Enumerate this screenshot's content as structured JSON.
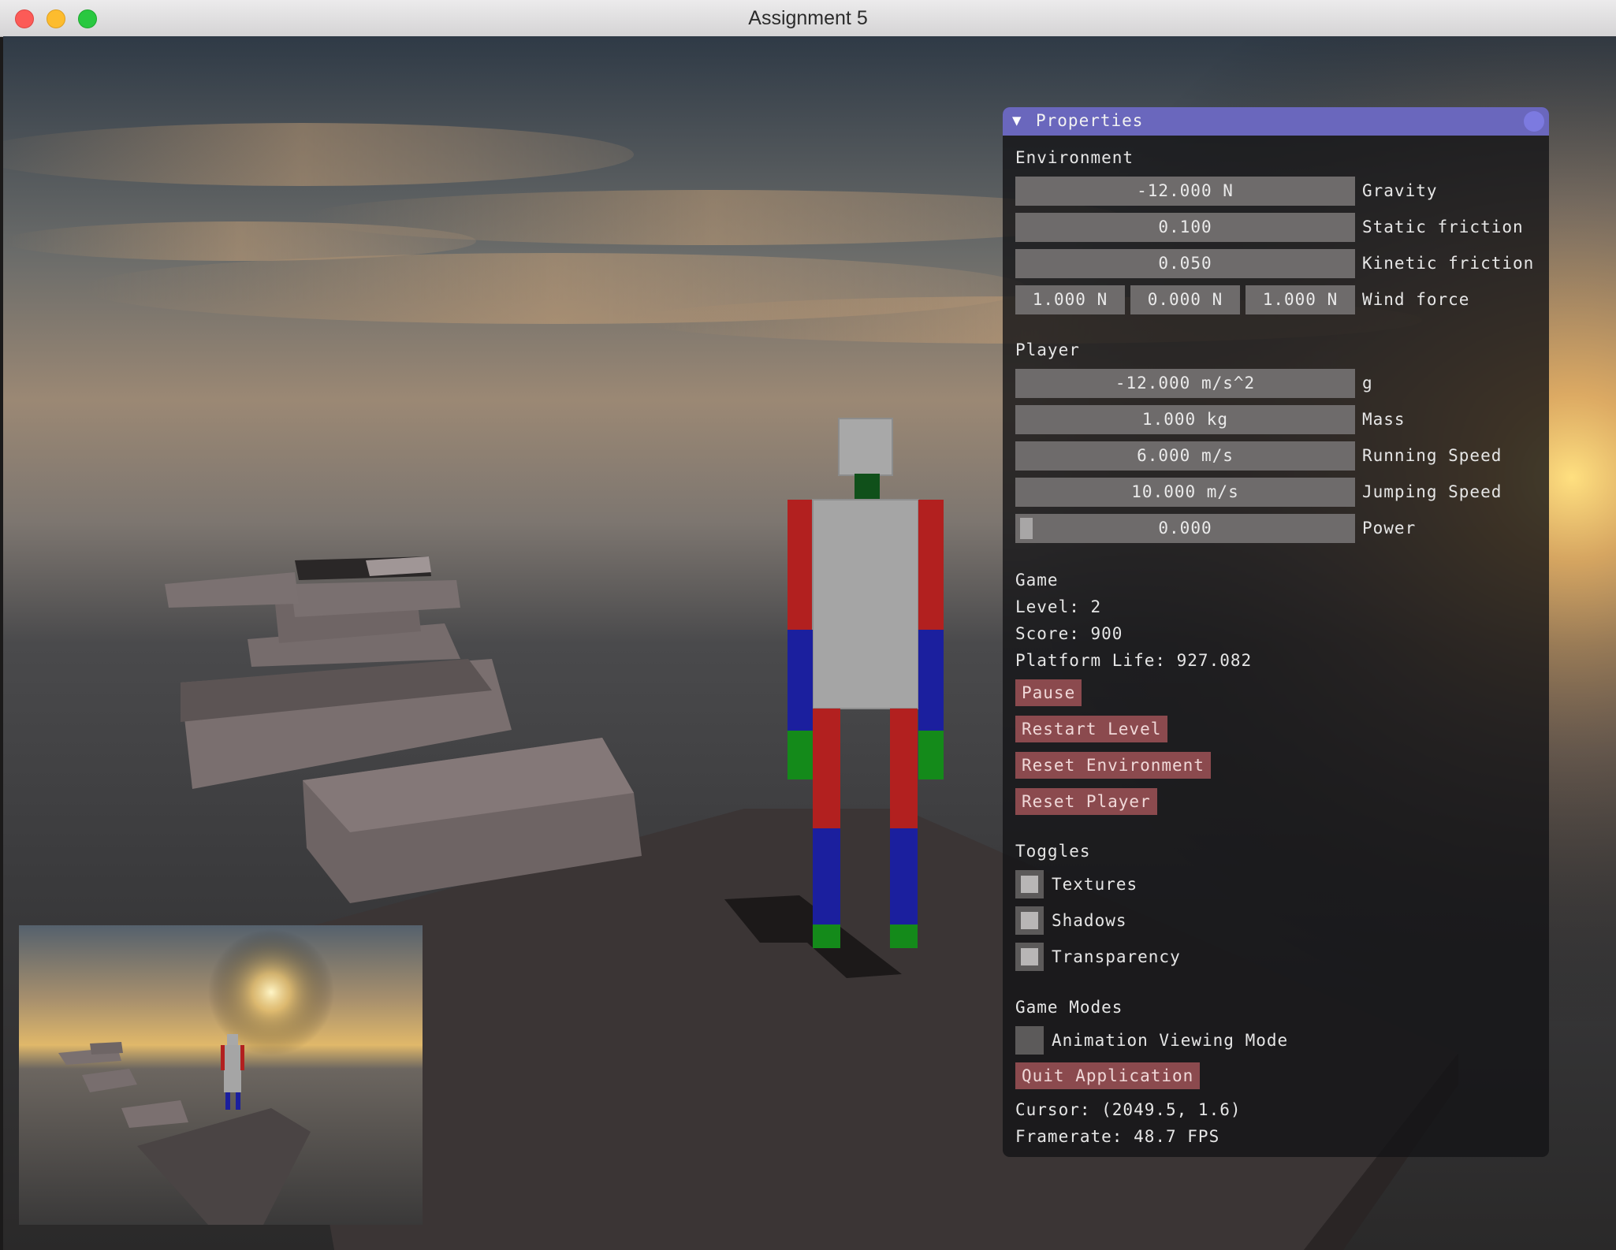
{
  "window": {
    "title": "Assignment 5"
  },
  "properties": {
    "title": "Properties",
    "environment": {
      "heading": "Environment",
      "gravity": {
        "value": "-12.000 N",
        "label": "Gravity"
      },
      "static_friction": {
        "value": "0.100",
        "label": "Static friction"
      },
      "kinetic_friction": {
        "value": "0.050",
        "label": "Kinetic friction"
      },
      "wind_force": {
        "x": "1.000 N",
        "y": "0.000 N",
        "z": "1.000 N",
        "label": "Wind force"
      }
    },
    "player": {
      "heading": "Player",
      "g": {
        "value": "-12.000 m/s^2",
        "label": "g"
      },
      "mass": {
        "value": "1.000 kg",
        "label": "Mass"
      },
      "running_speed": {
        "value": "6.000 m/s",
        "label": "Running Speed"
      },
      "jumping_speed": {
        "value": "10.000 m/s",
        "label": "Jumping Speed"
      },
      "power": {
        "value": "0.000",
        "label": "Power",
        "fraction": 0
      }
    },
    "game": {
      "heading": "Game",
      "level": "Level: 2",
      "score": "Score: 900",
      "platform_life": "Platform Life: 927.082",
      "pause": "Pause",
      "restart_level": "Restart Level",
      "reset_environment": "Reset Environment",
      "reset_player": "Reset Player"
    },
    "toggles": {
      "heading": "Toggles",
      "textures": {
        "label": "Textures",
        "checked": false
      },
      "shadows": {
        "label": "Shadows",
        "checked": false
      },
      "transparency": {
        "label": "Transparency",
        "checked": false
      }
    },
    "game_modes": {
      "heading": "Game Modes",
      "animation_viewing_mode": {
        "label": "Animation Viewing Mode",
        "checked": false
      },
      "quit": "Quit Application",
      "cursor": "Cursor: (2049.5, 1.6)",
      "framerate": "Framerate: 48.7 FPS"
    }
  },
  "colors": {
    "panel_header": "#6a67bd",
    "button": "#8b4a4e",
    "field": "#6e6b6b",
    "limb_red": "#b2201f",
    "limb_blue": "#1b1f9e",
    "limb_green": "#148a1a"
  }
}
